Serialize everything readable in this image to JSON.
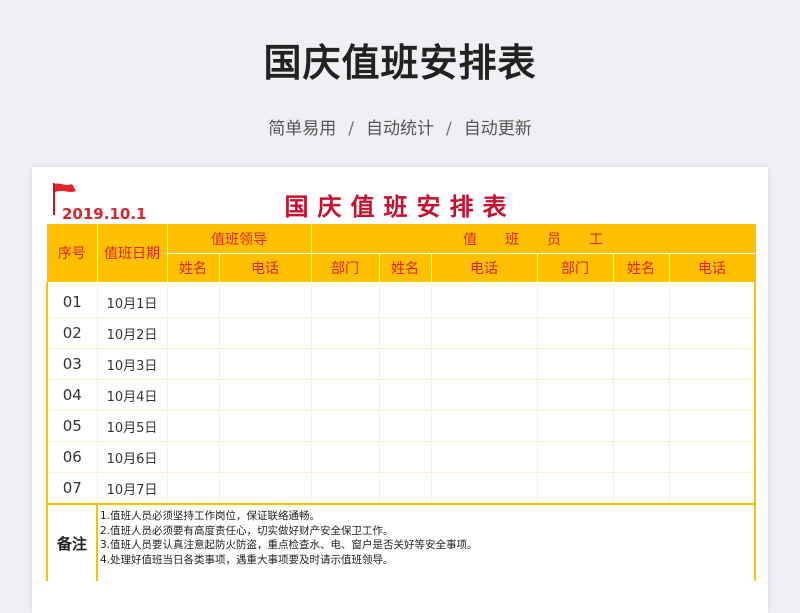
{
  "header": {
    "title": "国庆值班安排表",
    "subtitle_parts": [
      "简单易用",
      "自动统计",
      "自动更新"
    ],
    "separator": "/"
  },
  "sheet": {
    "date": "2019.10.1",
    "title": "国庆值班安排表",
    "columns": {
      "seq": "序号",
      "date": "值班日期",
      "leader_group": "值班领导",
      "staff_group": "值　　班　　员　　工",
      "name": "姓名",
      "phone": "电话",
      "dept": "部门"
    },
    "rows": [
      {
        "num": "01",
        "date": "10月1日"
      },
      {
        "num": "02",
        "date": "10月2日"
      },
      {
        "num": "03",
        "date": "10月3日"
      },
      {
        "num": "04",
        "date": "10月4日"
      },
      {
        "num": "05",
        "date": "10月5日"
      },
      {
        "num": "06",
        "date": "10月6日"
      },
      {
        "num": "07",
        "date": "10月7日"
      }
    ],
    "notes_label": "备注",
    "notes": [
      "1.值班人员必须坚持工作岗位，保证联络通畅。",
      "2.值班人员必须要有高度责任心，切实做好财产安全保卫工作。",
      "3.值班人员要认真注意起防火防盗，重点检查水、电、窗户是否关好等安全事项。",
      "4.处理好值班当日各类事项，遇重大事项要及时请示值班领导。"
    ]
  },
  "colors": {
    "header_fill": "#ffc000",
    "header_text": "#d9262e",
    "title_red": "#c8102e"
  }
}
